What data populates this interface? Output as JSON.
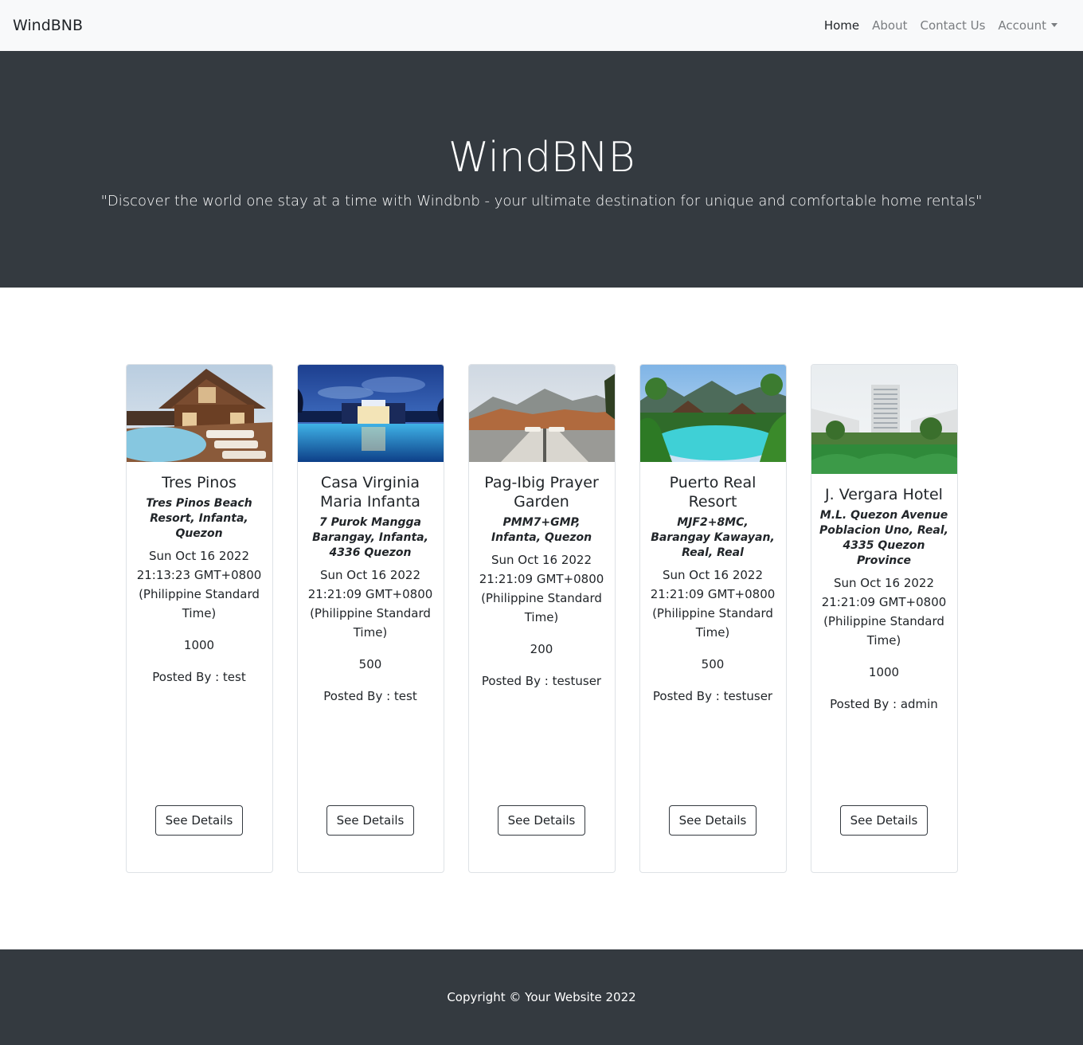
{
  "navbar": {
    "brand": "WindBNB",
    "links": [
      "Home",
      "About",
      "Contact Us",
      "Account"
    ]
  },
  "hero": {
    "title": "WindBNB",
    "tagline": "\"Discover the world one stay at a time with Windbnb - your ultimate destination for unique and comfortable home rentals\""
  },
  "listings": [
    {
      "title": "Tres Pinos",
      "address": "Tres Pinos Beach Resort, Infanta, Quezon",
      "date": "Sun Oct 16 2022 21:13:23 GMT+0800 (Philippine Standard Time)",
      "price": "1000",
      "posted_by": "Posted By : test",
      "button": "See Details",
      "image_icon": "resort-photo-icon"
    },
    {
      "title": "Casa Virginia Maria Infanta",
      "address": "7 Purok Mangga Barangay, Infanta, 4336 Quezon",
      "date": "Sun Oct 16 2022 21:21:09 GMT+0800 (Philippine Standard Time)",
      "price": "500",
      "posted_by": "Posted By : test",
      "button": "See Details",
      "image_icon": "pool-night-photo-icon"
    },
    {
      "title": "Pag-Ibig Prayer Garden",
      "address": "PMM7+GMP, Infanta, Quezon",
      "date": "Sun Oct 16 2022 21:21:09 GMT+0800 (Philippine Standard Time)",
      "price": "200",
      "posted_by": "Posted By : testuser",
      "button": "See Details",
      "image_icon": "mountain-view-photo-icon"
    },
    {
      "title": "Puerto Real Resort",
      "address": "MJF2+8MC, Barangay Kawayan, Real, Real",
      "date": "Sun Oct 16 2022 21:21:09 GMT+0800 (Philippine Standard Time)",
      "price": "500",
      "posted_by": "Posted By : testuser",
      "button": "See Details",
      "image_icon": "tropical-pool-photo-icon"
    },
    {
      "title": "J. Vergara Hotel",
      "address": "M.L. Quezon Avenue Poblacion Uno, Real, 4335 Quezon Province",
      "date": "Sun Oct 16 2022 21:21:09 GMT+0800 (Philippine Standard Time)",
      "price": "1000",
      "posted_by": "Posted By : admin",
      "button": "See Details",
      "image_icon": "hotel-tower-photo-icon"
    }
  ],
  "footer": {
    "copyright": "Copyright © Your Website 2022"
  },
  "colors": {
    "navbar_bg": "#f8f9fa",
    "dark_bg": "#343a40",
    "nav_muted": "#7a7d80"
  }
}
